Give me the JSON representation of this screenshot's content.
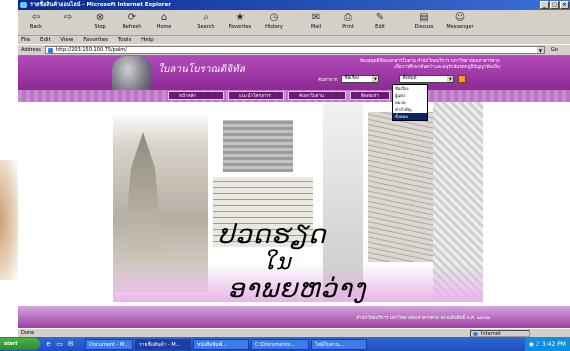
{
  "window": {
    "title": "รายชื่อสินค้าออนไลน์ - Microsoft Internet Explorer",
    "controls": [
      "_",
      "□",
      "×"
    ]
  },
  "toolbar": {
    "buttons": [
      {
        "label": "Back",
        "icon": "back-arrow-icon"
      },
      {
        "label": "",
        "icon": "forward-arrow-icon"
      },
      {
        "label": "Stop",
        "icon": "stop-icon"
      },
      {
        "label": "Refresh",
        "icon": "refresh-icon"
      },
      {
        "label": "Home",
        "icon": "home-icon"
      },
      {
        "label": "Search",
        "icon": "search-icon"
      },
      {
        "label": "Favorites",
        "icon": "favorites-icon"
      },
      {
        "label": "History",
        "icon": "history-icon"
      },
      {
        "label": "Mail",
        "icon": "mail-icon"
      },
      {
        "label": "Print",
        "icon": "print-icon"
      },
      {
        "label": "Edit",
        "icon": "edit-icon"
      },
      {
        "label": "Discuss",
        "icon": "discuss-icon"
      },
      {
        "label": "Messenger",
        "icon": "messenger-icon"
      }
    ]
  },
  "menubar": {
    "items": [
      "File",
      "Edit",
      "View",
      "Favorites",
      "Tools",
      "Help"
    ]
  },
  "addressbar": {
    "label": "Address",
    "url": "http://203.150.100.75/palm/",
    "go_label": "Go"
  },
  "site": {
    "name": "ใบลานโบราณดิจิทัล",
    "info_line1": "ห้องสมุดดิจิทัลเอกสารใบลาน สำนักวิทยบริการ มหาวิทยาลัยมหาสารคาม",
    "info_line2": "เพื่อการศึกษาค้นคว้าและอนุรักษ์มรดกภูมิปัญญาท้องถิ่น",
    "search_label": "ค้นหาจาก",
    "search_select_value": "ชื่อเรื่อง",
    "search_select2_value": "ทั้งหมด",
    "dropdown_options": [
      "ชื่อเรื่อง",
      "ผู้แต่ง",
      "หมวด",
      "คำสำคัญ",
      "ทั้งหมด"
    ],
    "nav_tabs": [
      "หน้าหลัก",
      "แนะนำโครงการ",
      "ค้นหาใบลาน",
      "ติดต่อเรา"
    ],
    "banner_title_line1": "ປວດຮຽດ",
    "banner_title_line2": "ໃນ",
    "banner_title_line3": "ອາພຍຫວ່າງ",
    "footer_text": "สำนักวิทยบริการ มหาวิทยาลัยมหาสารคาม สงวนลิขสิทธิ์ พ.ศ. ๒๕๔๗"
  },
  "statusbar": {
    "left": "Done",
    "zone": "Internet"
  },
  "taskbar": {
    "start_label": "start",
    "tasks": [
      "Document - M...",
      "รายชื่อสินค้า - M...",
      "หนังสือพิมพ์...",
      "C:\\Documents...",
      "ไฟล์ใบลาน..."
    ],
    "clock": "3:42 PM"
  }
}
